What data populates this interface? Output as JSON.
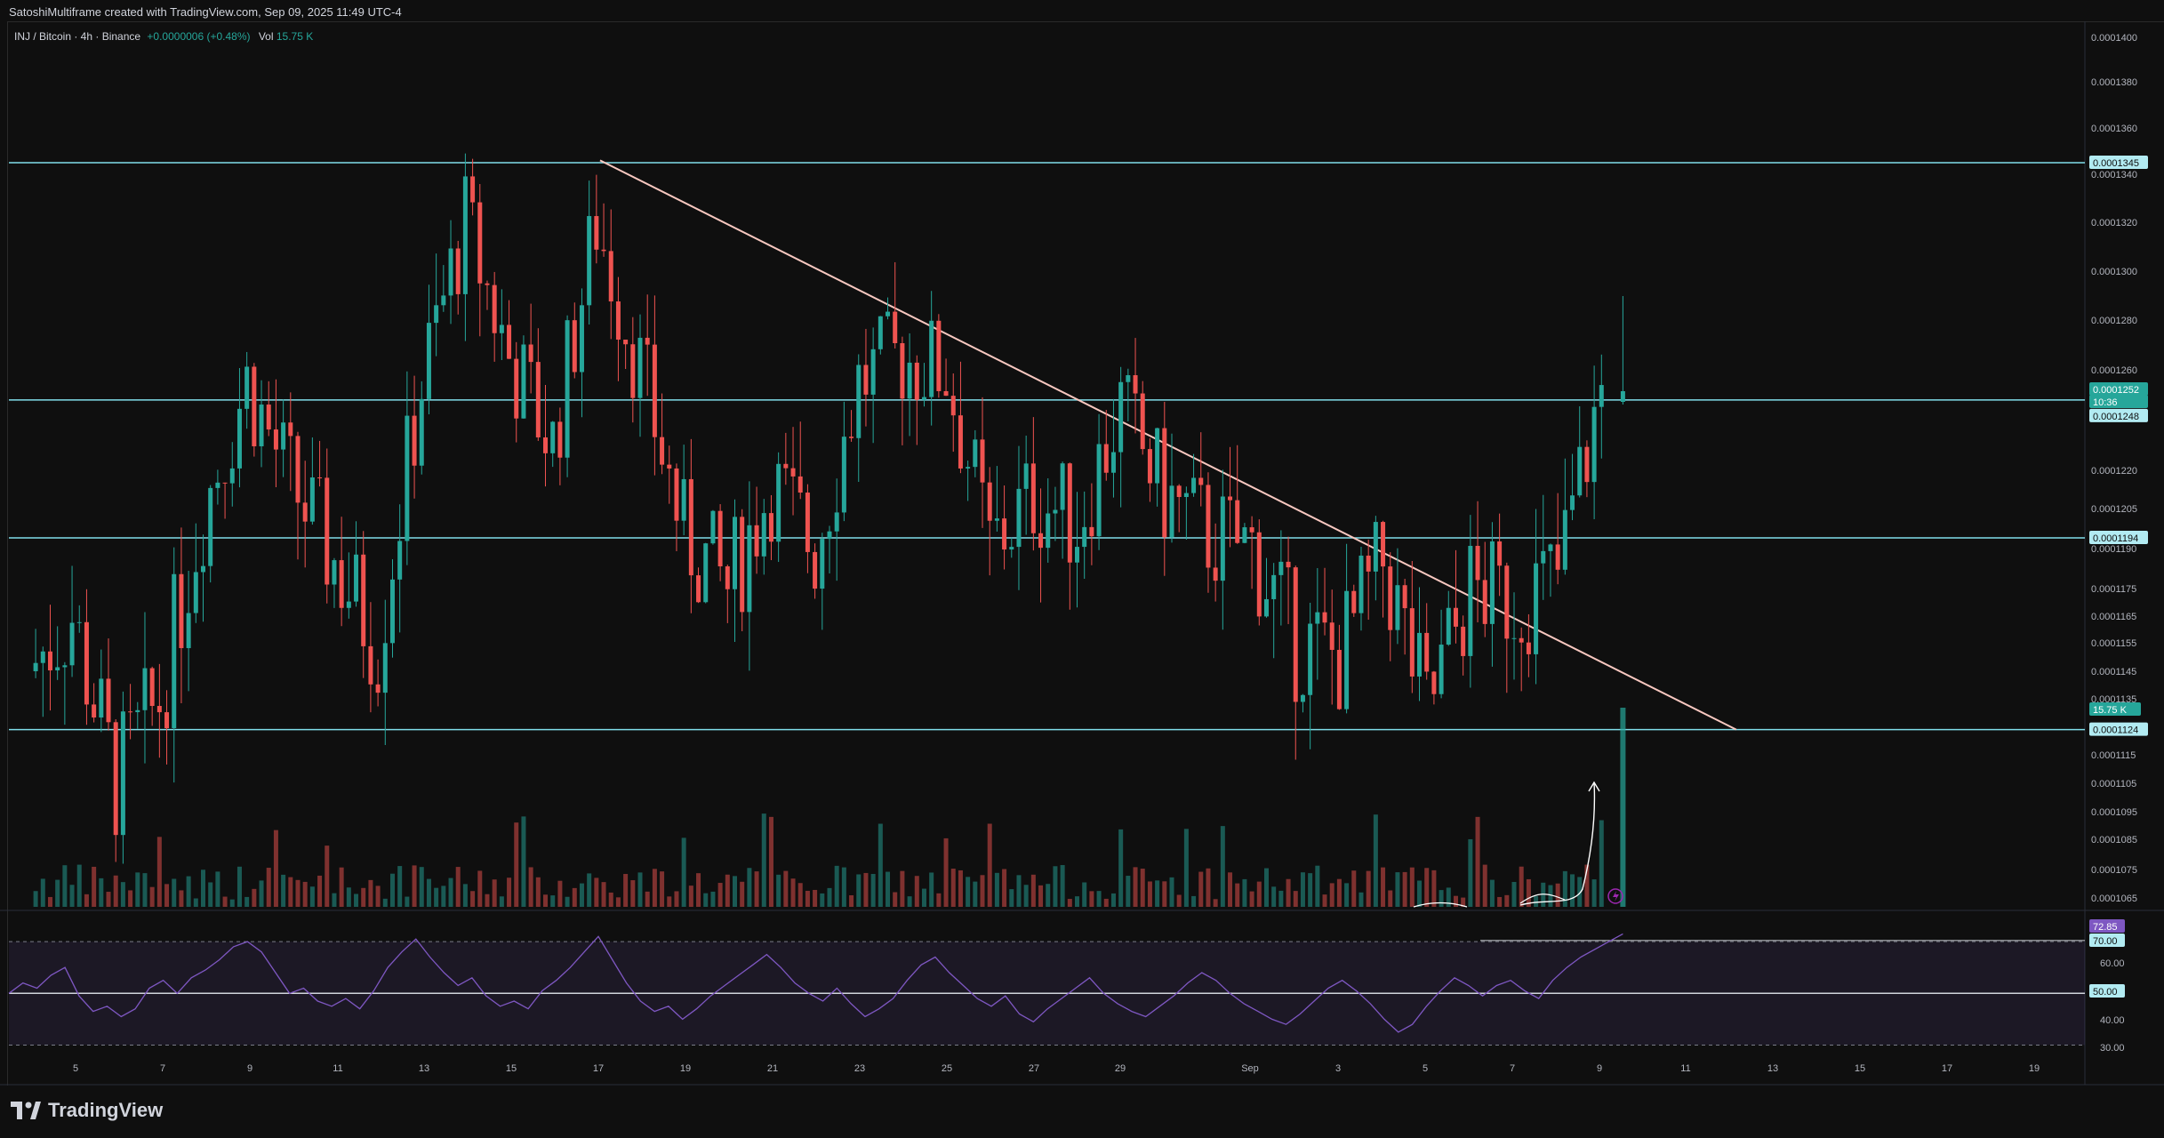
{
  "attribution": "SatoshiMultiframe created with TradingView.com, Sep 09, 2025 11:49 UTC-4",
  "symbol": {
    "name": "INJ / Bitcoin · 4h · Binance",
    "change": "+0.0000006 (+0.48%)",
    "vol_label": "Vol",
    "vol_value": "15.75 K"
  },
  "brand": "TradingView",
  "colors": {
    "up": "#26a69a",
    "down": "#ef5350",
    "level_line": "#80deea",
    "trendline": "#f8c8c0",
    "rsi_line": "#7e57c2",
    "background": "#0f0f0f"
  },
  "chart_data": [
    {
      "type": "candlestick",
      "title": "INJ / Bitcoin · 4h · Binance",
      "y_axis_ticks": [
        "0.0001400",
        "0.0001380",
        "0.0001360",
        "0.0001340",
        "0.0001320",
        "0.0001300",
        "0.0001280",
        "0.0001260",
        "0.0001220",
        "0.0001205",
        "0.0001190",
        "0.0001175",
        "0.0001165",
        "0.0001155",
        "0.0001145",
        "0.0001135",
        "0.0001115",
        "0.0001105",
        "0.0001095",
        "0.0001085",
        "0.0001075",
        "0.0001065"
      ],
      "x_axis_ticks": [
        "5",
        "7",
        "9",
        "11",
        "13",
        "15",
        "17",
        "19",
        "21",
        "23",
        "25",
        "27",
        "29",
        "Sep",
        "3",
        "5",
        "7",
        "9",
        "11",
        "13",
        "15",
        "17",
        "19"
      ],
      "price_labels": {
        "resistance": "0.0001345",
        "current": "0.0001252",
        "countdown": "10:36",
        "level_mid": "0.0001248",
        "level_low": "0.0001194",
        "support": "0.0001124",
        "volume": "15.75 K"
      },
      "horizontal_levels": [
        0.0001345,
        0.0001248,
        0.0001194,
        0.0001124
      ],
      "trendline": {
        "from": {
          "x": "Aug 17",
          "y": 0.0001346
        },
        "to": {
          "x": "Sep 12",
          "y": 0.0001124
        }
      },
      "closes_sample": [
        {
          "x": "Aug 4",
          "y": 0.0001145
        },
        {
          "x": "Aug 5",
          "y": 0.0001165
        },
        {
          "x": "Aug 6",
          "y": 0.0001105
        },
        {
          "x": "Aug 7",
          "y": 0.0001135
        },
        {
          "x": "Aug 8",
          "y": 0.0001205
        },
        {
          "x": "Aug 9",
          "y": 0.0001255
        },
        {
          "x": "Aug 10",
          "y": 0.0001215
        },
        {
          "x": "Aug 11",
          "y": 0.0001185
        },
        {
          "x": "Aug 12",
          "y": 0.0001155
        },
        {
          "x": "Aug 13",
          "y": 0.0001255
        },
        {
          "x": "Aug 14",
          "y": 0.000132
        },
        {
          "x": "Aug 15",
          "y": 0.0001265
        },
        {
          "x": "Aug 16",
          "y": 0.000123
        },
        {
          "x": "Aug 17",
          "y": 0.000132
        },
        {
          "x": "Aug 18",
          "y": 0.000126
        },
        {
          "x": "Aug 19",
          "y": 0.0001195
        },
        {
          "x": "Aug 20",
          "y": 0.0001175
        },
        {
          "x": "Aug 21",
          "y": 0.0001215
        },
        {
          "x": "Aug 22",
          "y": 0.000119
        },
        {
          "x": "Aug 23",
          "y": 0.0001255
        },
        {
          "x": "Aug 24",
          "y": 0.0001265
        },
        {
          "x": "Aug 25",
          "y": 0.000126
        },
        {
          "x": "Aug 26",
          "y": 0.000119
        },
        {
          "x": "Aug 27",
          "y": 0.000121
        },
        {
          "x": "Aug 28",
          "y": 0.00012
        },
        {
          "x": "Aug 29",
          "y": 0.0001245
        },
        {
          "x": "Aug 30",
          "y": 0.000121
        },
        {
          "x": "Aug 31",
          "y": 0.0001195
        },
        {
          "x": "Sep 1",
          "y": 0.000119
        },
        {
          "x": "Sep 2",
          "y": 0.0001155
        },
        {
          "x": "Sep 3",
          "y": 0.000115
        },
        {
          "x": "Sep 4",
          "y": 0.0001185
        },
        {
          "x": "Sep 5",
          "y": 0.000113
        },
        {
          "x": "Sep 6",
          "y": 0.0001175
        },
        {
          "x": "Sep 7",
          "y": 0.000117
        },
        {
          "x": "Sep 8",
          "y": 0.000118
        },
        {
          "x": "Sep 9",
          "y": 0.0001252
        }
      ]
    },
    {
      "type": "line",
      "title": "RSI",
      "y_axis_ticks": [
        "70.00",
        "60.00",
        "50.00",
        "40.00",
        "30.00"
      ],
      "value_labels": {
        "current": "72.85",
        "overbought": "70.00",
        "mid": "50.00"
      },
      "ylim": [
        25,
        80
      ],
      "series": [
        {
          "values": [
            50,
            54,
            52,
            57,
            60,
            49,
            43,
            45,
            41,
            44,
            52,
            55,
            50,
            56,
            59,
            63,
            68,
            70,
            66,
            58,
            50,
            52,
            47,
            45,
            48,
            44,
            51,
            60,
            66,
            71,
            64,
            58,
            53,
            56,
            49,
            45,
            47,
            44,
            51,
            55,
            60,
            66,
            72,
            63,
            54,
            47,
            43,
            45,
            40,
            44,
            49,
            53,
            57,
            61,
            65,
            60,
            54,
            50,
            47,
            52,
            46,
            41,
            44,
            48,
            55,
            61,
            64,
            58,
            53,
            48,
            45,
            49,
            42,
            39,
            44,
            48,
            52,
            56,
            50,
            46,
            43,
            41,
            45,
            49,
            54,
            58,
            55,
            50,
            46,
            43,
            40,
            38,
            42,
            47,
            52,
            55,
            51,
            46,
            40,
            35,
            38,
            45,
            51,
            56,
            53,
            49,
            53,
            55,
            51,
            48,
            55,
            60,
            64,
            67,
            70,
            73
          ]
        }
      ]
    }
  ]
}
